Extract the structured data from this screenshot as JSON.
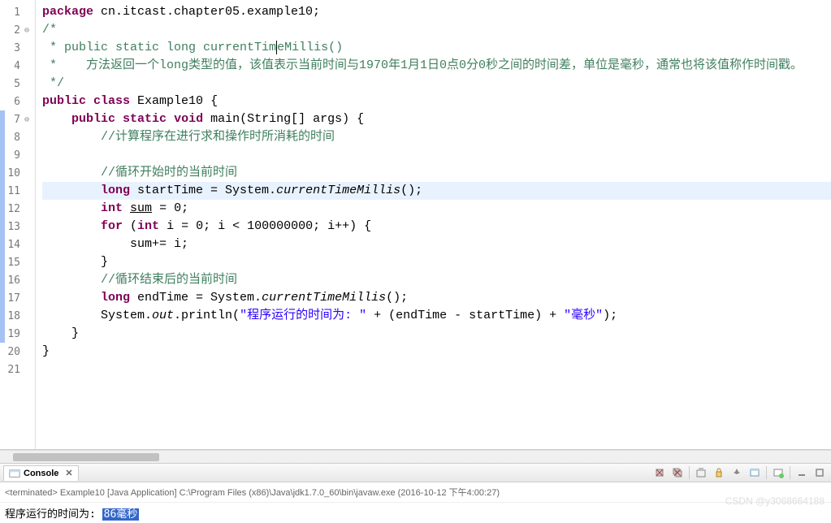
{
  "code": {
    "lines": [
      {
        "n": "1",
        "fold": "",
        "html": "<span class='kw'>package</span> cn.itcast.chapter05.example10;"
      },
      {
        "n": "2",
        "fold": "⊖",
        "html": "<span class='comment'>/*</span>"
      },
      {
        "n": "3",
        "fold": "",
        "html": " <span class='comment'>* public static long currentTim<span style='border-left:1px solid #000'>e</span>Millis()</span>"
      },
      {
        "n": "4",
        "fold": "",
        "html": " <span class='comment'>*    方法返回一个long类型的值，该值表示当前时间与1970年1月1日0点0分0秒之间的时间差，单位是毫秒，通常也将该值称作时间戳。</span>"
      },
      {
        "n": "5",
        "fold": "",
        "html": " <span class='comment'>*/</span>"
      },
      {
        "n": "6",
        "fold": "",
        "html": "<span class='kw'>public</span> <span class='kw'>class</span> Example10 {"
      },
      {
        "n": "7",
        "fold": "⊖",
        "html": "    <span class='kw'>public</span> <span class='kw'>static</span> <span class='kw'>void</span> main(String[] args) {"
      },
      {
        "n": "8",
        "fold": "",
        "html": "        <span class='comment'>//计算程序在进行求和操作时所消耗的时间</span>"
      },
      {
        "n": "9",
        "fold": "",
        "html": ""
      },
      {
        "n": "10",
        "fold": "",
        "html": "        <span class='comment'>//循环开始时的当前时间</span>"
      },
      {
        "n": "11",
        "fold": "",
        "html": "        <span class='kw'>long</span> startTime = System.<span class='italic'>currentTimeMillis</span>();",
        "hl": true
      },
      {
        "n": "12",
        "fold": "",
        "html": "        <span class='kw'>int</span> <span class='underline'>sum</span> = 0;"
      },
      {
        "n": "13",
        "fold": "",
        "html": "        <span class='kw'>for</span> (<span class='kw'>int</span> i = 0; i &lt; 100000000; i++) {"
      },
      {
        "n": "14",
        "fold": "",
        "html": "            sum+= i;"
      },
      {
        "n": "15",
        "fold": "",
        "html": "        }"
      },
      {
        "n": "16",
        "fold": "",
        "html": "        <span class='comment'>//循环结束后的当前时间</span>"
      },
      {
        "n": "17",
        "fold": "",
        "html": "        <span class='kw'>long</span> endTime = System.<span class='italic'>currentTimeMillis</span>();"
      },
      {
        "n": "18",
        "fold": "",
        "html": "        System.<span class='italic'>out</span>.println(<span class='str'>\"程序运行的时间为: \"</span> + (endTime - startTime) + <span class='str'>\"毫秒\"</span>);"
      },
      {
        "n": "19",
        "fold": "",
        "html": "    }"
      },
      {
        "n": "20",
        "fold": "",
        "html": "}"
      },
      {
        "n": "21",
        "fold": "",
        "html": ""
      }
    ],
    "markers": [
      {
        "start": 7,
        "end": 19
      }
    ]
  },
  "console": {
    "tab_label": "Console",
    "status": "<terminated> Example10 [Java Application] C:\\Program Files (x86)\\Java\\jdk1.7.0_60\\bin\\javaw.exe (2016-10-12 下午4:00:27)",
    "output_prefix": "程序运行的时间为: ",
    "output_value": "86毫秒"
  },
  "watermark": "CSDN @y3068664188"
}
